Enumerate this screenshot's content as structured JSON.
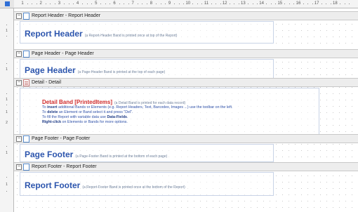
{
  "ruler": {
    "numbers": [
      "1",
      "2",
      "3",
      "4",
      "5",
      "6",
      "7",
      "8",
      "9",
      "10",
      "11",
      "12",
      "13",
      "14",
      "15",
      "16",
      "17",
      "18"
    ],
    "left_numbers": [
      "1",
      "1",
      "1",
      "1",
      "2",
      "1",
      "1"
    ]
  },
  "bands": {
    "report_header": {
      "bar_label": "Report Header - Report Header",
      "title": "Report Header",
      "note": "(a Report-Header Band is printed once at top of the Report)"
    },
    "page_header": {
      "bar_label": "Page Header - Page Header",
      "title": "Page Header",
      "note": "(a Page-Header Band is printed at the top of each page)"
    },
    "detail": {
      "bar_label": "Detail - Detail",
      "title": "Detail Band [PrintedItems]",
      "note": "(a Detail Band is printed for each data record)",
      "line1_pre": "To ",
      "line1_bold": "insert",
      "line1_post": " additional Bands or Elements (e.g. Report Headers, Text, Barcodes, Images ...) use the toolbar on the left.",
      "line2_pre": "To ",
      "line2_bold": "delete",
      "line2_post": " an Element or Band select it and press \"Del\".",
      "line3_pre": "To fill the Report with variable data use ",
      "line3_bold": "Data-Fields",
      "line3_post": ".",
      "line4_bold": "Right-click",
      "line4_post": " on Elements or Bands for more options."
    },
    "page_footer": {
      "bar_label": "Page Footer - Page Footer",
      "title": "Page Footer",
      "note": "(a Page-Footer Band is printed at the bottom of each page)"
    },
    "report_footer": {
      "bar_label": "Report Footer - Report Footer",
      "title": "Report Footer",
      "note": "(a Report-Footer Band is printed once at the bottom of the Report)"
    }
  },
  "icons": {
    "collapse": "minus-box-icon",
    "band": "band-page-icon",
    "detail": "detail-list-icon"
  },
  "colors": {
    "title_blue": "#2c55ad",
    "detail_red": "#cf2b2b",
    "note_gray": "#6d7f9a"
  }
}
